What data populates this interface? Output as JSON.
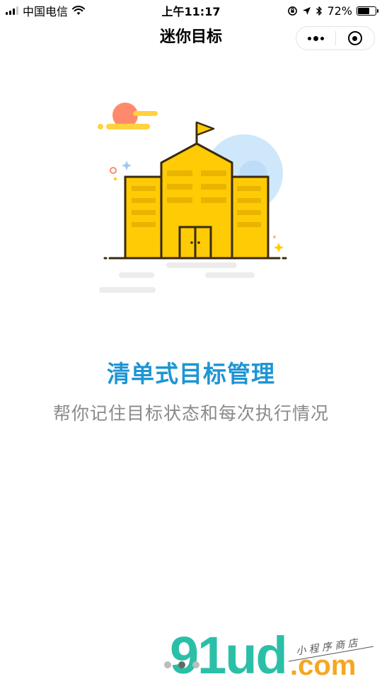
{
  "status_bar": {
    "carrier": "中国电信",
    "time": "上午11:17",
    "battery_percent": "72%",
    "battery_level": 0.72,
    "icons": [
      "signal-icon",
      "wifi-icon",
      "orientation-lock-icon",
      "location-icon",
      "bluetooth-icon",
      "battery-icon"
    ]
  },
  "nav": {
    "title": "迷你目标",
    "menu_icon": "more-dots-icon",
    "close_icon": "target-icon"
  },
  "onboarding": {
    "headline": "清单式目标管理",
    "description": "帮你记住目标状态和每次执行情况",
    "illustration": "school-building-illustration",
    "page_count": 3,
    "active_page": 2
  },
  "watermark": {
    "brand": "91ud",
    "suffix": ".com",
    "tagline": "小程序商店"
  },
  "colors": {
    "headline": "#1e95d4",
    "subtext": "#8a8a8a",
    "building": "#ffcb05",
    "building_dark": "#e8b400",
    "outline": "#3a2a10",
    "sun": "#ff8a6b",
    "sky_circle": "#cfe7fb",
    "watermark_teal": "#2bbfa8",
    "watermark_orange": "#f5a623"
  }
}
